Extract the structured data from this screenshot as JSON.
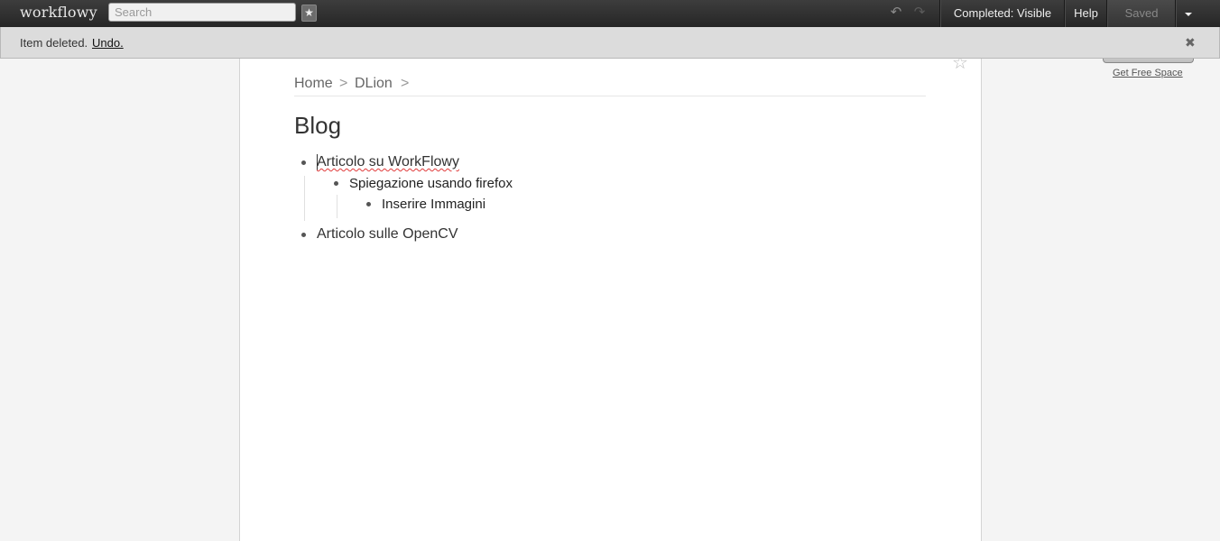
{
  "topbar": {
    "logo": "workflowy",
    "search_placeholder": "Search",
    "completed_label": "Completed: Visible",
    "help_label": "Help",
    "saved_label": "Saved"
  },
  "notification": {
    "message": "Item deleted.",
    "undo_label": "Undo."
  },
  "breadcrumb": [
    "Home",
    "DLion"
  ],
  "breadcrumb_separator": ">",
  "page_title": "Blog",
  "outline": [
    {
      "text": "Articolo su WorkFlowy",
      "children": [
        {
          "text": "Spiegazione usando firefox",
          "children": [
            {
              "text": "Inserire Immagini"
            }
          ]
        }
      ]
    },
    {
      "text": "Articolo sulle OpenCV"
    }
  ],
  "sidebar": {
    "free_space_link": "Get Free Space"
  },
  "icons": {
    "search_star": "star-icon",
    "undo": "undo-icon",
    "redo": "redo-icon",
    "dropdown": "chevron-down-icon",
    "close": "close-icon",
    "page_star": "star-outline-icon"
  }
}
